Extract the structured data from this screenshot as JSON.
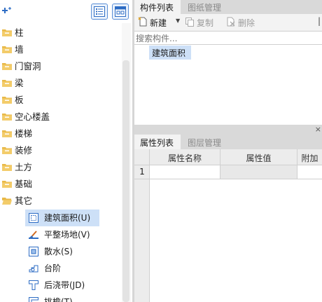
{
  "tree": {
    "folders": [
      "柱",
      "墙",
      "门窗洞",
      "梁",
      "板",
      "空心楼盖",
      "楼梯",
      "装修",
      "土方",
      "基础",
      "其它"
    ],
    "children": [
      "建筑面积(U)",
      "平整场地(V)",
      "散水(S)",
      "台阶",
      "后浇带(JD)",
      "挑檐(T)"
    ],
    "selected_child": "建筑面积(U)"
  },
  "component_panel": {
    "tabs": [
      "构件列表",
      "图纸管理"
    ],
    "active_tab": "构件列表",
    "toolbar": {
      "new_label": "新建",
      "copy_label": "复制",
      "delete_label": "删除"
    },
    "search_placeholder": "搜索构件...",
    "items": [
      "建筑面积"
    ]
  },
  "property_panel": {
    "tabs": [
      "属性列表",
      "图层管理"
    ],
    "active_tab": "属性列表",
    "columns": [
      "属性名称",
      "属性值",
      "附加"
    ],
    "rows": [
      {
        "index": "1",
        "name": "",
        "value": "",
        "extra": ""
      }
    ]
  },
  "colors": {
    "selection": "#cde0f7",
    "folder": "#e8b948",
    "accent": "#2d6cc4"
  }
}
